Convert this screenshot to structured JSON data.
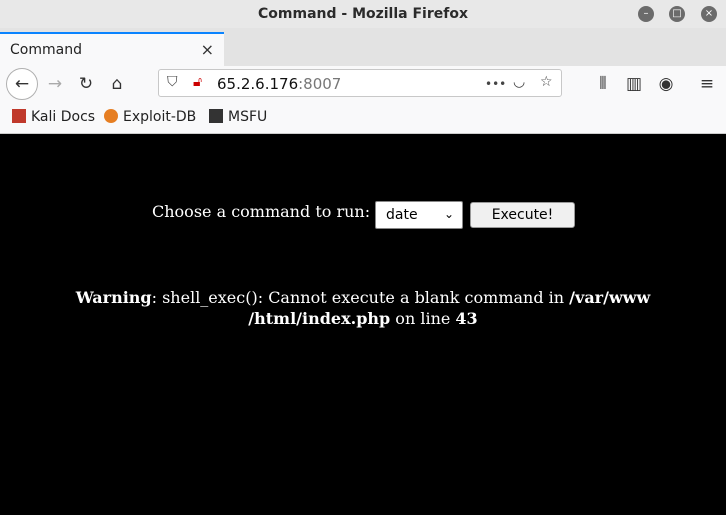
{
  "window": {
    "title": "Command - Mozilla Firefox"
  },
  "tabs": [
    {
      "label": "Command",
      "close": "×"
    }
  ],
  "newtab": "+",
  "nav": {
    "url_host": "65.2.6.176",
    "url_port": ":8007",
    "more": "•••"
  },
  "bookmarks": [
    {
      "label": "Kali Docs",
      "icon": "kali-docs-icon"
    },
    {
      "label": "Exploit-DB",
      "icon": "exploitdb-icon"
    },
    {
      "label": "MSFU",
      "icon": "msfu-icon"
    }
  ],
  "page": {
    "prompt": "Choose a command to run:",
    "select_value": "date",
    "execute_label": "Execute!",
    "warning": {
      "label": "Warning",
      "text1": ": shell_exec(): Cannot execute a blank command in ",
      "path1": "/var/www",
      "path2": "/html/index.php",
      "text2": " on line ",
      "line": "43"
    }
  },
  "colors": {
    "accent": "#0a84ff",
    "page_bg": "#000000"
  }
}
